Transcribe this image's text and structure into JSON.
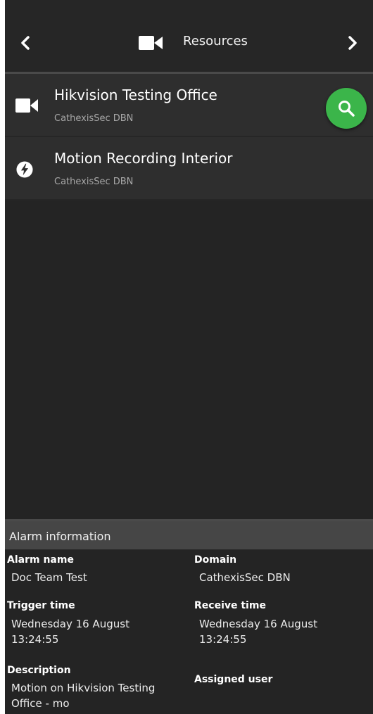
{
  "header": {
    "title": "Resources",
    "icons": {
      "back": "chevron-left-icon",
      "forward": "chevron-right-icon",
      "camera": "video-camera-icon"
    }
  },
  "resources": [
    {
      "title": "Hikvision Testing Office",
      "subtitle": "CathexisSec DBN",
      "icon": "video-camera-icon"
    },
    {
      "title": "Motion Recording Interior",
      "subtitle": "CathexisSec DBN",
      "icon": "lightning-bolt-icon"
    }
  ],
  "search_fab": {
    "icon": "search-icon",
    "color": "#3bb54a"
  },
  "alarm": {
    "section_title": "Alarm information",
    "alarm_name_label": "Alarm name",
    "alarm_name_value": "Doc Team Test",
    "domain_label": "Domain",
    "domain_value": "CathexisSec DBN",
    "trigger_time_label": "Trigger time",
    "trigger_time_value": "Wednesday 16 August 13:24:55",
    "receive_time_label": "Receive time",
    "receive_time_value": "Wednesday 16 August 13:24:55",
    "description_label": "Description",
    "description_value": "Motion on Hikvision Testing Office - mo",
    "assigned_user_label": "Assigned user"
  }
}
